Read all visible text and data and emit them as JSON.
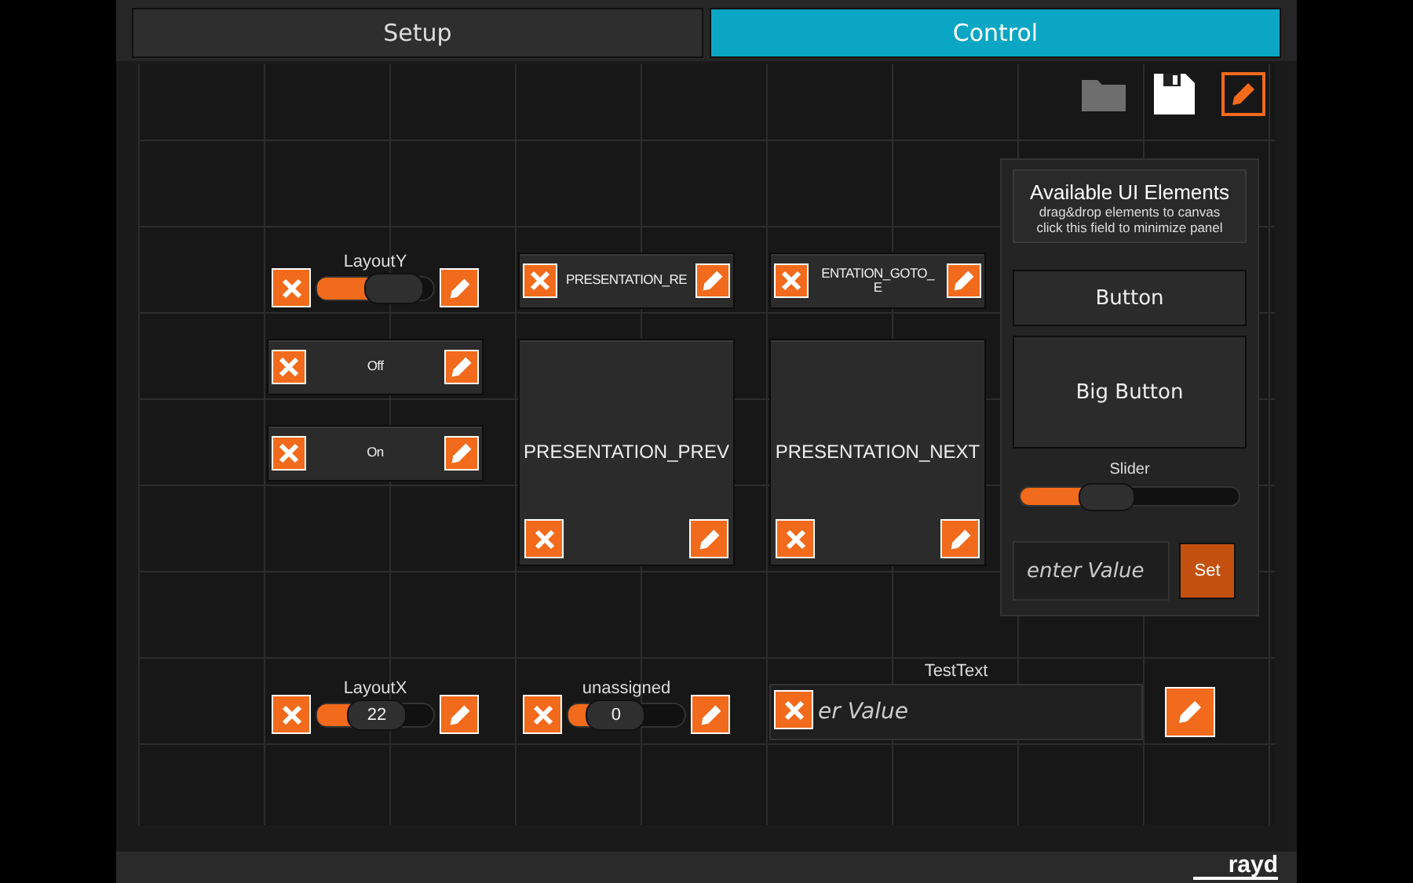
{
  "tabs": [
    {
      "label": "Setup",
      "selected": false
    },
    {
      "label": "Control",
      "selected": true
    }
  ],
  "canvas": {
    "widgets": [
      {
        "kind": "slider",
        "label": "LayoutY",
        "level": 0.8
      },
      {
        "kind": "button",
        "label": "PRESENTATION_RE"
      },
      {
        "kind": "button",
        "label": "ENTATION_GOTO_\nE"
      },
      {
        "kind": "button",
        "label": "Off"
      },
      {
        "kind": "button",
        "label": "On"
      },
      {
        "kind": "bigbutton",
        "label": "PRESENTATION_PREV"
      },
      {
        "kind": "bigbutton",
        "label": "PRESENTATION_NEXT"
      },
      {
        "kind": "slider",
        "label": "LayoutX",
        "level": 0.5,
        "value": "22"
      },
      {
        "kind": "slider",
        "label": "unassigned",
        "level": 0.3,
        "value": "0"
      },
      {
        "kind": "textfield",
        "label": "TestText",
        "placeholder": "er Value"
      }
    ]
  },
  "panel": {
    "title": "Available UI Elements",
    "subtitle": "drag&drop elements to canvas",
    "hint": "click this field to minimize panel",
    "button": "Button",
    "big_button": "Big Button",
    "slider": {
      "label": "Slider",
      "level": 0.35
    },
    "field_placeholder": "enter Value",
    "set_button": "Set"
  },
  "footer": {
    "logo": "rayd"
  }
}
